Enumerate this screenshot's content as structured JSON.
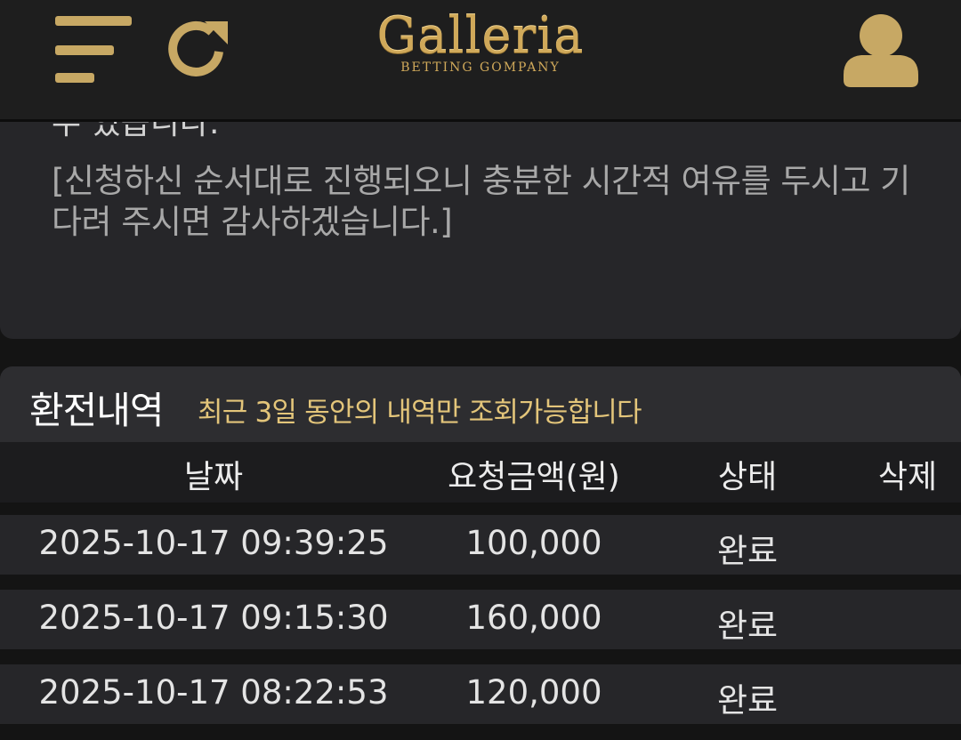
{
  "header": {
    "logo_title": "Galleria",
    "logo_subtitle": "BETTING GOMPANY",
    "brand_color": "#c7a864",
    "icons": [
      "menu-icon",
      "refresh-icon",
      "user-icon"
    ]
  },
  "notice": {
    "clipped_text": "수 있습니다.",
    "text": "[신청하신 순서대로 진행되오니 충분한 시간적 여유를 두시고 기다려 주시면 감사하겠습니다.]"
  },
  "history": {
    "title": "환전내역",
    "subtitle": "최근 3일 동안의 내역만 조회가능합니다",
    "columns": [
      "날짜",
      "요청금액(원)",
      "상태",
      "삭제"
    ],
    "rows": [
      {
        "date": "2025-10-17 09:39:25",
        "amount": "100,000",
        "status": "완료",
        "delete": ""
      },
      {
        "date": "2025-10-17 09:15:30",
        "amount": "160,000",
        "status": "완료",
        "delete": ""
      },
      {
        "date": "2025-10-17 08:22:53",
        "amount": "120,000",
        "status": "완료",
        "delete": ""
      }
    ]
  }
}
